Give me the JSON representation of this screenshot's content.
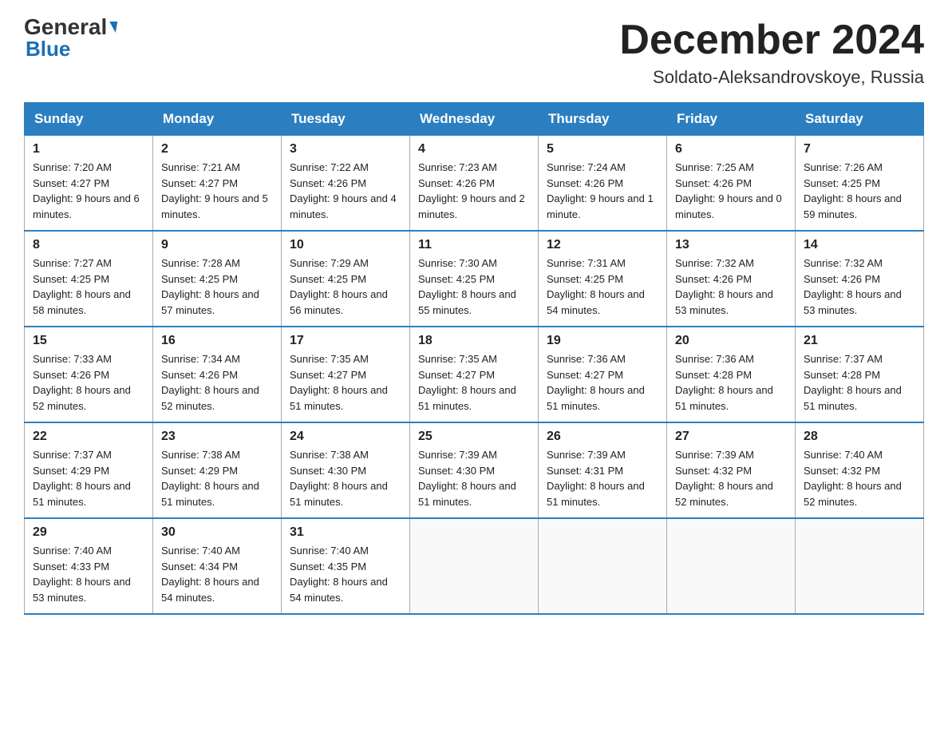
{
  "header": {
    "logo_general": "General",
    "logo_blue": "Blue",
    "month_title": "December 2024",
    "location": "Soldato-Aleksandrovskoye, Russia"
  },
  "days_of_week": [
    "Sunday",
    "Monday",
    "Tuesday",
    "Wednesday",
    "Thursday",
    "Friday",
    "Saturday"
  ],
  "weeks": [
    [
      {
        "day": "1",
        "sunrise": "7:20 AM",
        "sunset": "4:27 PM",
        "daylight": "9 hours and 6 minutes."
      },
      {
        "day": "2",
        "sunrise": "7:21 AM",
        "sunset": "4:27 PM",
        "daylight": "9 hours and 5 minutes."
      },
      {
        "day": "3",
        "sunrise": "7:22 AM",
        "sunset": "4:26 PM",
        "daylight": "9 hours and 4 minutes."
      },
      {
        "day": "4",
        "sunrise": "7:23 AM",
        "sunset": "4:26 PM",
        "daylight": "9 hours and 2 minutes."
      },
      {
        "day": "5",
        "sunrise": "7:24 AM",
        "sunset": "4:26 PM",
        "daylight": "9 hours and 1 minute."
      },
      {
        "day": "6",
        "sunrise": "7:25 AM",
        "sunset": "4:26 PM",
        "daylight": "9 hours and 0 minutes."
      },
      {
        "day": "7",
        "sunrise": "7:26 AM",
        "sunset": "4:25 PM",
        "daylight": "8 hours and 59 minutes."
      }
    ],
    [
      {
        "day": "8",
        "sunrise": "7:27 AM",
        "sunset": "4:25 PM",
        "daylight": "8 hours and 58 minutes."
      },
      {
        "day": "9",
        "sunrise": "7:28 AM",
        "sunset": "4:25 PM",
        "daylight": "8 hours and 57 minutes."
      },
      {
        "day": "10",
        "sunrise": "7:29 AM",
        "sunset": "4:25 PM",
        "daylight": "8 hours and 56 minutes."
      },
      {
        "day": "11",
        "sunrise": "7:30 AM",
        "sunset": "4:25 PM",
        "daylight": "8 hours and 55 minutes."
      },
      {
        "day": "12",
        "sunrise": "7:31 AM",
        "sunset": "4:25 PM",
        "daylight": "8 hours and 54 minutes."
      },
      {
        "day": "13",
        "sunrise": "7:32 AM",
        "sunset": "4:26 PM",
        "daylight": "8 hours and 53 minutes."
      },
      {
        "day": "14",
        "sunrise": "7:32 AM",
        "sunset": "4:26 PM",
        "daylight": "8 hours and 53 minutes."
      }
    ],
    [
      {
        "day": "15",
        "sunrise": "7:33 AM",
        "sunset": "4:26 PM",
        "daylight": "8 hours and 52 minutes."
      },
      {
        "day": "16",
        "sunrise": "7:34 AM",
        "sunset": "4:26 PM",
        "daylight": "8 hours and 52 minutes."
      },
      {
        "day": "17",
        "sunrise": "7:35 AM",
        "sunset": "4:27 PM",
        "daylight": "8 hours and 51 minutes."
      },
      {
        "day": "18",
        "sunrise": "7:35 AM",
        "sunset": "4:27 PM",
        "daylight": "8 hours and 51 minutes."
      },
      {
        "day": "19",
        "sunrise": "7:36 AM",
        "sunset": "4:27 PM",
        "daylight": "8 hours and 51 minutes."
      },
      {
        "day": "20",
        "sunrise": "7:36 AM",
        "sunset": "4:28 PM",
        "daylight": "8 hours and 51 minutes."
      },
      {
        "day": "21",
        "sunrise": "7:37 AM",
        "sunset": "4:28 PM",
        "daylight": "8 hours and 51 minutes."
      }
    ],
    [
      {
        "day": "22",
        "sunrise": "7:37 AM",
        "sunset": "4:29 PM",
        "daylight": "8 hours and 51 minutes."
      },
      {
        "day": "23",
        "sunrise": "7:38 AM",
        "sunset": "4:29 PM",
        "daylight": "8 hours and 51 minutes."
      },
      {
        "day": "24",
        "sunrise": "7:38 AM",
        "sunset": "4:30 PM",
        "daylight": "8 hours and 51 minutes."
      },
      {
        "day": "25",
        "sunrise": "7:39 AM",
        "sunset": "4:30 PM",
        "daylight": "8 hours and 51 minutes."
      },
      {
        "day": "26",
        "sunrise": "7:39 AM",
        "sunset": "4:31 PM",
        "daylight": "8 hours and 51 minutes."
      },
      {
        "day": "27",
        "sunrise": "7:39 AM",
        "sunset": "4:32 PM",
        "daylight": "8 hours and 52 minutes."
      },
      {
        "day": "28",
        "sunrise": "7:40 AM",
        "sunset": "4:32 PM",
        "daylight": "8 hours and 52 minutes."
      }
    ],
    [
      {
        "day": "29",
        "sunrise": "7:40 AM",
        "sunset": "4:33 PM",
        "daylight": "8 hours and 53 minutes."
      },
      {
        "day": "30",
        "sunrise": "7:40 AM",
        "sunset": "4:34 PM",
        "daylight": "8 hours and 54 minutes."
      },
      {
        "day": "31",
        "sunrise": "7:40 AM",
        "sunset": "4:35 PM",
        "daylight": "8 hours and 54 minutes."
      },
      null,
      null,
      null,
      null
    ]
  ]
}
